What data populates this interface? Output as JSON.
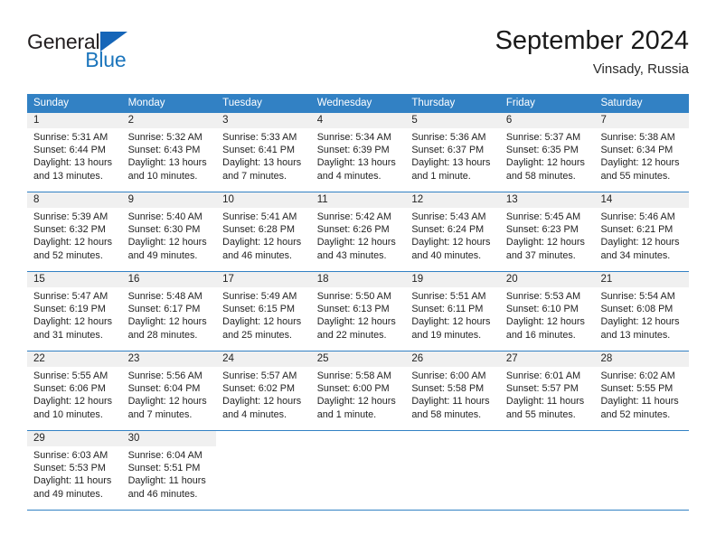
{
  "logo": {
    "word1": "General",
    "word2": "Blue",
    "triangle_color": "#1565b8",
    "word2_color": "#1b75bc"
  },
  "header": {
    "title": "September 2024",
    "location": "Vinsady, Russia"
  },
  "theme": {
    "header_blue": "#3281c4",
    "daynumber_gray": "#f0f0f0",
    "text": "#232323"
  },
  "weekdays": [
    "Sunday",
    "Monday",
    "Tuesday",
    "Wednesday",
    "Thursday",
    "Friday",
    "Saturday"
  ],
  "weeks": [
    [
      {
        "day": "1",
        "sunrise": "Sunrise: 5:31 AM",
        "sunset": "Sunset: 6:44 PM",
        "daylight1": "Daylight: 13 hours",
        "daylight2": "and 13 minutes."
      },
      {
        "day": "2",
        "sunrise": "Sunrise: 5:32 AM",
        "sunset": "Sunset: 6:43 PM",
        "daylight1": "Daylight: 13 hours",
        "daylight2": "and 10 minutes."
      },
      {
        "day": "3",
        "sunrise": "Sunrise: 5:33 AM",
        "sunset": "Sunset: 6:41 PM",
        "daylight1": "Daylight: 13 hours",
        "daylight2": "and 7 minutes."
      },
      {
        "day": "4",
        "sunrise": "Sunrise: 5:34 AM",
        "sunset": "Sunset: 6:39 PM",
        "daylight1": "Daylight: 13 hours",
        "daylight2": "and 4 minutes."
      },
      {
        "day": "5",
        "sunrise": "Sunrise: 5:36 AM",
        "sunset": "Sunset: 6:37 PM",
        "daylight1": "Daylight: 13 hours",
        "daylight2": "and 1 minute."
      },
      {
        "day": "6",
        "sunrise": "Sunrise: 5:37 AM",
        "sunset": "Sunset: 6:35 PM",
        "daylight1": "Daylight: 12 hours",
        "daylight2": "and 58 minutes."
      },
      {
        "day": "7",
        "sunrise": "Sunrise: 5:38 AM",
        "sunset": "Sunset: 6:34 PM",
        "daylight1": "Daylight: 12 hours",
        "daylight2": "and 55 minutes."
      }
    ],
    [
      {
        "day": "8",
        "sunrise": "Sunrise: 5:39 AM",
        "sunset": "Sunset: 6:32 PM",
        "daylight1": "Daylight: 12 hours",
        "daylight2": "and 52 minutes."
      },
      {
        "day": "9",
        "sunrise": "Sunrise: 5:40 AM",
        "sunset": "Sunset: 6:30 PM",
        "daylight1": "Daylight: 12 hours",
        "daylight2": "and 49 minutes."
      },
      {
        "day": "10",
        "sunrise": "Sunrise: 5:41 AM",
        "sunset": "Sunset: 6:28 PM",
        "daylight1": "Daylight: 12 hours",
        "daylight2": "and 46 minutes."
      },
      {
        "day": "11",
        "sunrise": "Sunrise: 5:42 AM",
        "sunset": "Sunset: 6:26 PM",
        "daylight1": "Daylight: 12 hours",
        "daylight2": "and 43 minutes."
      },
      {
        "day": "12",
        "sunrise": "Sunrise: 5:43 AM",
        "sunset": "Sunset: 6:24 PM",
        "daylight1": "Daylight: 12 hours",
        "daylight2": "and 40 minutes."
      },
      {
        "day": "13",
        "sunrise": "Sunrise: 5:45 AM",
        "sunset": "Sunset: 6:23 PM",
        "daylight1": "Daylight: 12 hours",
        "daylight2": "and 37 minutes."
      },
      {
        "day": "14",
        "sunrise": "Sunrise: 5:46 AM",
        "sunset": "Sunset: 6:21 PM",
        "daylight1": "Daylight: 12 hours",
        "daylight2": "and 34 minutes."
      }
    ],
    [
      {
        "day": "15",
        "sunrise": "Sunrise: 5:47 AM",
        "sunset": "Sunset: 6:19 PM",
        "daylight1": "Daylight: 12 hours",
        "daylight2": "and 31 minutes."
      },
      {
        "day": "16",
        "sunrise": "Sunrise: 5:48 AM",
        "sunset": "Sunset: 6:17 PM",
        "daylight1": "Daylight: 12 hours",
        "daylight2": "and 28 minutes."
      },
      {
        "day": "17",
        "sunrise": "Sunrise: 5:49 AM",
        "sunset": "Sunset: 6:15 PM",
        "daylight1": "Daylight: 12 hours",
        "daylight2": "and 25 minutes."
      },
      {
        "day": "18",
        "sunrise": "Sunrise: 5:50 AM",
        "sunset": "Sunset: 6:13 PM",
        "daylight1": "Daylight: 12 hours",
        "daylight2": "and 22 minutes."
      },
      {
        "day": "19",
        "sunrise": "Sunrise: 5:51 AM",
        "sunset": "Sunset: 6:11 PM",
        "daylight1": "Daylight: 12 hours",
        "daylight2": "and 19 minutes."
      },
      {
        "day": "20",
        "sunrise": "Sunrise: 5:53 AM",
        "sunset": "Sunset: 6:10 PM",
        "daylight1": "Daylight: 12 hours",
        "daylight2": "and 16 minutes."
      },
      {
        "day": "21",
        "sunrise": "Sunrise: 5:54 AM",
        "sunset": "Sunset: 6:08 PM",
        "daylight1": "Daylight: 12 hours",
        "daylight2": "and 13 minutes."
      }
    ],
    [
      {
        "day": "22",
        "sunrise": "Sunrise: 5:55 AM",
        "sunset": "Sunset: 6:06 PM",
        "daylight1": "Daylight: 12 hours",
        "daylight2": "and 10 minutes."
      },
      {
        "day": "23",
        "sunrise": "Sunrise: 5:56 AM",
        "sunset": "Sunset: 6:04 PM",
        "daylight1": "Daylight: 12 hours",
        "daylight2": "and 7 minutes."
      },
      {
        "day": "24",
        "sunrise": "Sunrise: 5:57 AM",
        "sunset": "Sunset: 6:02 PM",
        "daylight1": "Daylight: 12 hours",
        "daylight2": "and 4 minutes."
      },
      {
        "day": "25",
        "sunrise": "Sunrise: 5:58 AM",
        "sunset": "Sunset: 6:00 PM",
        "daylight1": "Daylight: 12 hours",
        "daylight2": "and 1 minute."
      },
      {
        "day": "26",
        "sunrise": "Sunrise: 6:00 AM",
        "sunset": "Sunset: 5:58 PM",
        "daylight1": "Daylight: 11 hours",
        "daylight2": "and 58 minutes."
      },
      {
        "day": "27",
        "sunrise": "Sunrise: 6:01 AM",
        "sunset": "Sunset: 5:57 PM",
        "daylight1": "Daylight: 11 hours",
        "daylight2": "and 55 minutes."
      },
      {
        "day": "28",
        "sunrise": "Sunrise: 6:02 AM",
        "sunset": "Sunset: 5:55 PM",
        "daylight1": "Daylight: 11 hours",
        "daylight2": "and 52 minutes."
      }
    ],
    [
      {
        "day": "29",
        "sunrise": "Sunrise: 6:03 AM",
        "sunset": "Sunset: 5:53 PM",
        "daylight1": "Daylight: 11 hours",
        "daylight2": "and 49 minutes."
      },
      {
        "day": "30",
        "sunrise": "Sunrise: 6:04 AM",
        "sunset": "Sunset: 5:51 PM",
        "daylight1": "Daylight: 11 hours",
        "daylight2": "and 46 minutes."
      },
      {
        "day": "",
        "sunrise": "",
        "sunset": "",
        "daylight1": "",
        "daylight2": ""
      },
      {
        "day": "",
        "sunrise": "",
        "sunset": "",
        "daylight1": "",
        "daylight2": ""
      },
      {
        "day": "",
        "sunrise": "",
        "sunset": "",
        "daylight1": "",
        "daylight2": ""
      },
      {
        "day": "",
        "sunrise": "",
        "sunset": "",
        "daylight1": "",
        "daylight2": ""
      },
      {
        "day": "",
        "sunrise": "",
        "sunset": "",
        "daylight1": "",
        "daylight2": ""
      }
    ]
  ]
}
